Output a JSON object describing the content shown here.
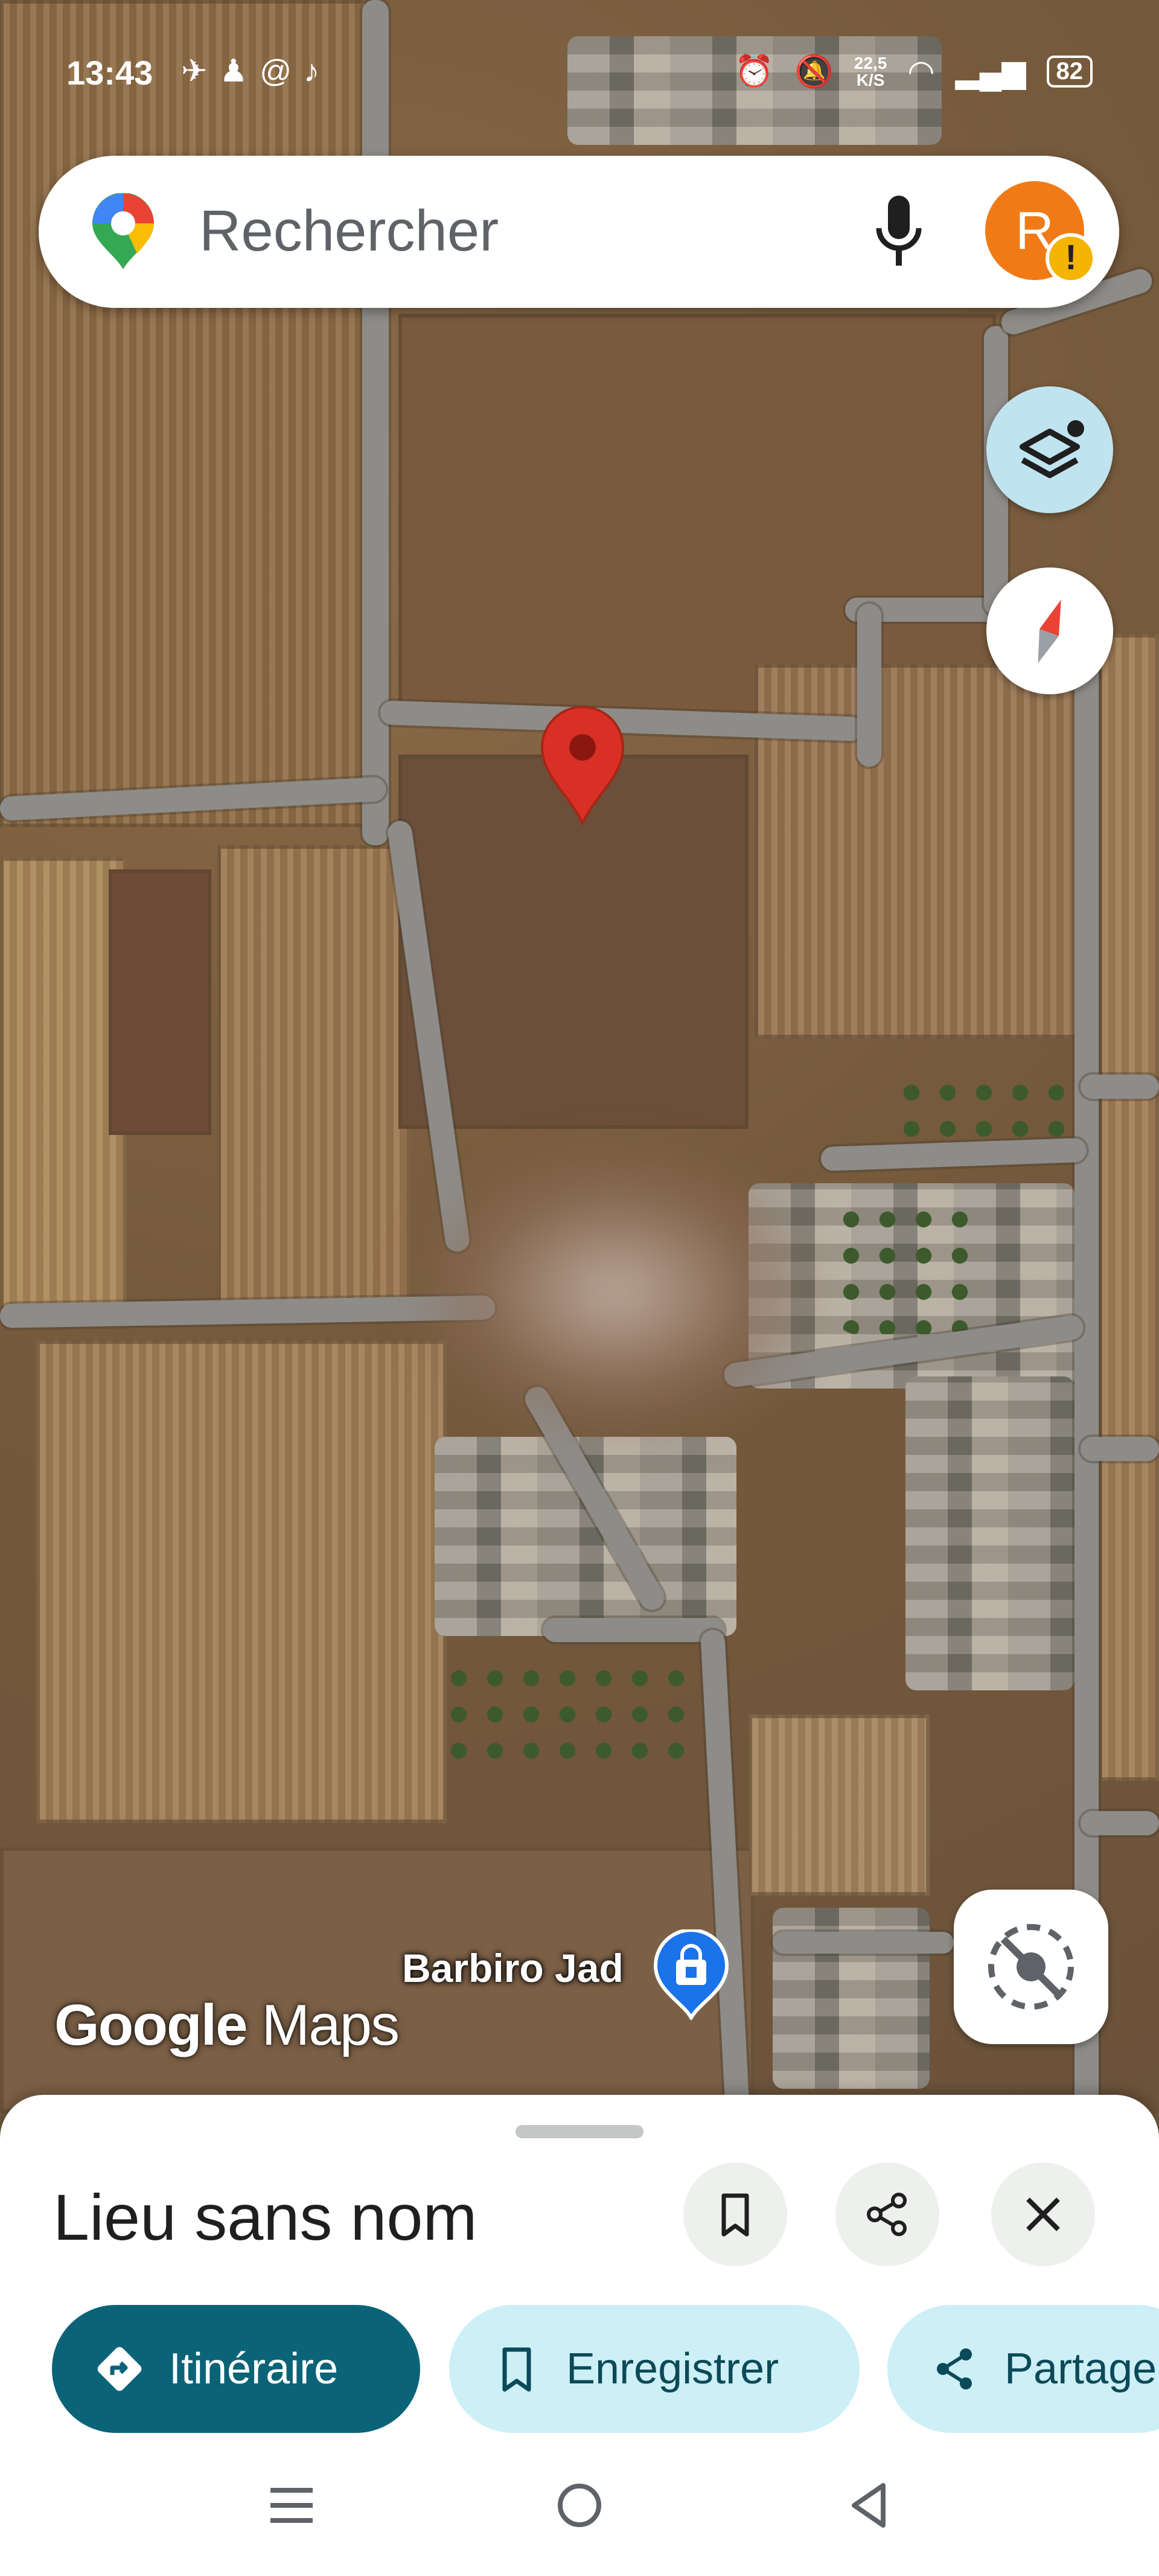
{
  "status_bar": {
    "time": "13:43",
    "speed_value": "22,5",
    "speed_unit": "K/S",
    "battery": "82"
  },
  "search": {
    "placeholder": "Rechercher",
    "avatar_initial": "R",
    "warning_badge": "!"
  },
  "map": {
    "poi_label": "Barbiro Jad",
    "logo_google": "Google",
    "logo_maps": "Maps",
    "pin_color": "#d93025",
    "layers_button_color": "#bfe4f0"
  },
  "place_sheet": {
    "title": "Lieu sans nom",
    "actions": {
      "directions_label": "Itinéraire",
      "save_label": "Enregistrer",
      "share_label": "Partager"
    }
  },
  "colors": {
    "primary_button": "#0b6378",
    "secondary_button": "#cdeff6"
  }
}
